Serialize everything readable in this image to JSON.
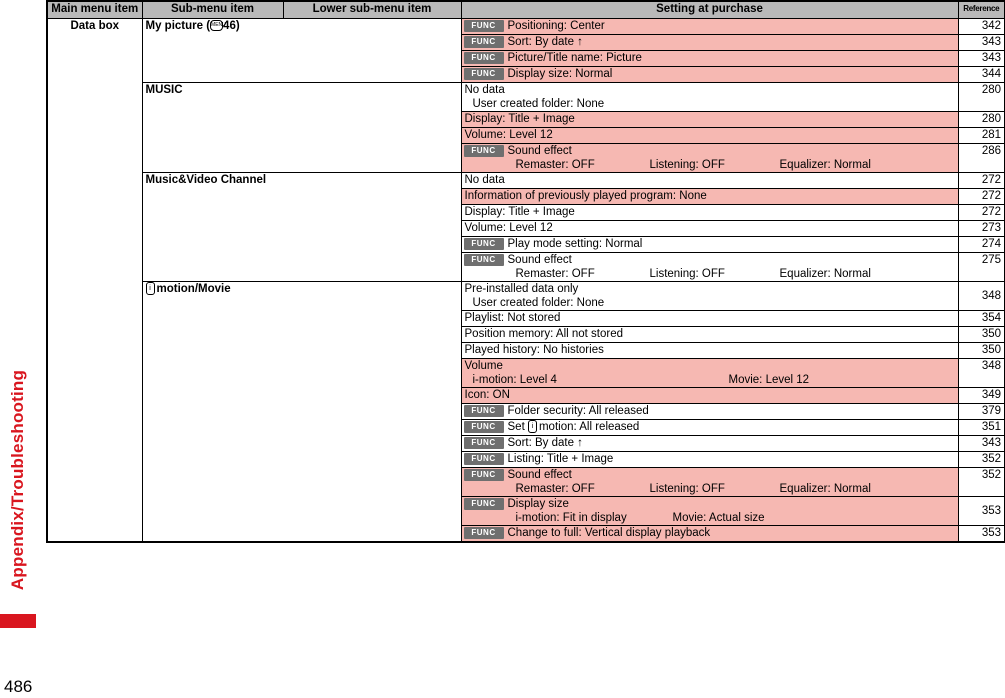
{
  "side_label": "Appendix/Troubleshooting",
  "page_number": "486",
  "headers": {
    "main": "Main menu item",
    "sub": "Sub-menu item",
    "lower": "Lower sub-menu item",
    "setting": "Setting at purchase",
    "reference": "Reference"
  },
  "icons": {
    "func": "FUNC"
  },
  "main_item": "Data box",
  "groups": {
    "my_picture": {
      "label": "My picture (",
      "menu_badge": "MENU",
      "label_suffix": "46)",
      "rows": [
        {
          "text": "Positioning: Center",
          "ref": "342"
        },
        {
          "text": "Sort: By date ↑",
          "ref": "343"
        },
        {
          "text": "Picture/Title name: Picture",
          "ref": "343"
        },
        {
          "text": "Display size: Normal",
          "ref": "344"
        }
      ]
    },
    "music": {
      "label": "MUSIC",
      "rows": [
        {
          "text": "No data",
          "sub": "User created folder: None",
          "ref": "280"
        },
        {
          "text": "Display: Title + Image",
          "ref": "280"
        },
        {
          "text": "Volume: Level 12",
          "ref": "281"
        },
        {
          "text": "Sound effect",
          "cols": [
            "Remaster: OFF",
            "Listening: OFF",
            "Equalizer: Normal"
          ],
          "ref": "286"
        }
      ]
    },
    "mvc": {
      "label": "Music&Video Channel",
      "rows": [
        {
          "text": "No data",
          "ref": "272"
        },
        {
          "text": "Information of previously played program: None",
          "ref": "272"
        },
        {
          "text": "Display: Title + Image",
          "ref": "272"
        },
        {
          "text": "Volume: Level 12",
          "ref": "273"
        },
        {
          "text": "Play mode setting: Normal",
          "ref": "274"
        },
        {
          "text": "Sound effect",
          "cols": [
            "Remaster: OFF",
            "Listening: OFF",
            "Equalizer: Normal"
          ],
          "ref": "275"
        }
      ]
    },
    "imotion": {
      "mark": "i",
      "label": "motion/Movie",
      "rows": [
        {
          "text": "Pre-installed data only",
          "sub": "User created folder: None",
          "ref": "348"
        },
        {
          "text": "Playlist: Not stored",
          "ref": "354"
        },
        {
          "text": "Position memory: All not stored",
          "ref": "350"
        },
        {
          "text": "Played history: No histories",
          "ref": "350"
        },
        {
          "text": "Volume",
          "cols": [
            "i-motion: Level 4",
            "Movie: Level 12"
          ],
          "ref": "348"
        },
        {
          "text": "Icon: ON",
          "ref": "349"
        },
        {
          "text": "Folder security: All released",
          "ref": "379"
        },
        {
          "text": "Set ",
          "mark": "i",
          "text_suffix": "motion: All released",
          "ref": "351"
        },
        {
          "text": "Sort: By date ↑",
          "ref": "343"
        },
        {
          "text": "Listing: Title + Image",
          "ref": "352"
        },
        {
          "text": "Sound effect",
          "cols": [
            "Remaster: OFF",
            "Listening: OFF",
            "Equalizer: Normal"
          ],
          "ref": "352"
        },
        {
          "text": "Display size",
          "cols": [
            "i-motion: Fit in display",
            "Movie: Actual size"
          ],
          "ref": "353"
        },
        {
          "text": "Change to full: Vertical display playback",
          "ref": "353"
        }
      ]
    }
  },
  "colors": {
    "accent_red": "#d9161f",
    "row_pink": "#f6b8b2",
    "header_gray": "#b9b9b9",
    "func_gray": "#6f6f6f"
  }
}
